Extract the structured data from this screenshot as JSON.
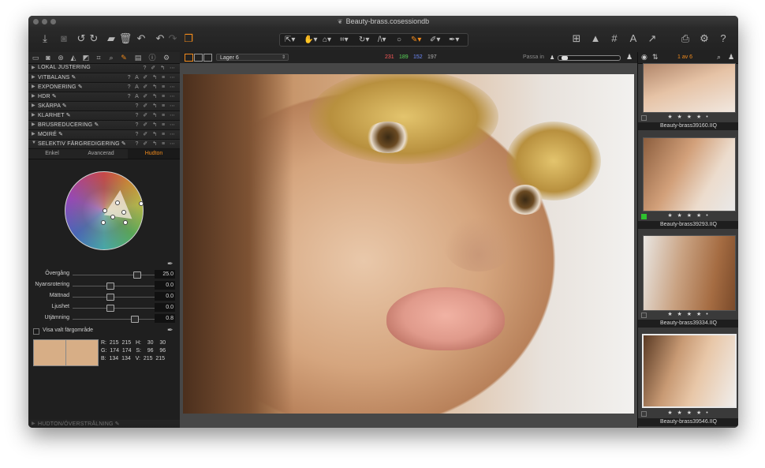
{
  "window": {
    "title": "Beauty-brass.cosessiondb"
  },
  "toolbar": {
    "left_icons": [
      "import-icon",
      "camera-icon",
      "rotate-left-icon",
      "rotate-right-icon",
      "folder-icon",
      "trash-icon",
      "undo-all-icon",
      "undo-icon",
      "redo-icon",
      "stack-icon"
    ],
    "cursor_tools": [
      "pointer-tool-icon",
      "pan-tool-icon",
      "loupe-tool-icon",
      "crop-tool-icon",
      "rotate-tool-icon",
      "keystone-tool-icon",
      "spot-tool-icon",
      "brush-tool-icon",
      "picker-tool-icon",
      "color-picker-tool-icon"
    ],
    "right_icons": [
      "grid-view-icon",
      "warning-icon",
      "overlay-grid-icon",
      "text-annotation-icon",
      "copy-apply-icon",
      "print-icon",
      "settings-icon",
      "help-icon"
    ]
  },
  "left_panel": {
    "tool_tabs": [
      "library-tab-icon",
      "capture-tab-icon",
      "color-tab-icon",
      "exposure-tab-icon",
      "lens-tab-icon",
      "crop-tab-icon",
      "details-tab-icon",
      "local-adjust-tab-icon",
      "metadata-tab-icon",
      "output-tab-icon",
      "batch-tab-icon"
    ],
    "tools": [
      {
        "label": "LOKAL JUSTERING",
        "controls": "? ✐ ↰ ⋯"
      },
      {
        "label": "VITBALANS ✎",
        "controls": "? A ✐ ↰ ≡ ⋯"
      },
      {
        "label": "EXPONERING ✎",
        "controls": "? A ✐ ↰ ≡ ⋯"
      },
      {
        "label": "HDR ✎",
        "controls": "? A ✐ ↰ ≡ ⋯"
      },
      {
        "label": "SKÄRPA ✎",
        "controls": "? ✐ ↰ ≡ ⋯"
      },
      {
        "label": "KLARHET ✎",
        "controls": "? ✐ ↰ ≡ ⋯"
      },
      {
        "label": "BRUSREDUCERING ✎",
        "controls": "? ✐ ↰ ≡ ⋯"
      },
      {
        "label": "MOIRÉ ✎",
        "controls": "? ✐ ↰ ≡ ⋯"
      },
      {
        "label": "SELEKTIV FÄRGREDIGERING ✎",
        "controls": "? ✐ ↰ ≡ ⋯"
      }
    ],
    "subtabs": [
      "Enkel",
      "Avancerad",
      "Hudton"
    ],
    "active_subtab": "Hudton",
    "sliders": [
      {
        "label": "Övergång",
        "value": "25.0",
        "level": 0.78
      },
      {
        "label": "Nyansrotering",
        "value": "0.0",
        "level": 0.45
      },
      {
        "label": "Mättnad",
        "value": "0.0",
        "level": 0.45
      },
      {
        "label": "Ljushet",
        "value": "0.0",
        "level": 0.45
      },
      {
        "label": "Utjämning",
        "value": "0.8",
        "level": 0.75
      }
    ],
    "show_range_label": "Visa valt färgområde",
    "readout": {
      "line1": "R:  215  215   H:    30    30",
      "line2": "G:  174  174   S:    96    96",
      "line3": "B:  134  134   V:  215  215"
    },
    "swatch_color": "#d7ae86",
    "bottom_tool_label": "HUDTON/ÖVERSTRÅLNING ✎"
  },
  "viewer": {
    "layer_label": "Lager 6",
    "rgb": {
      "r": "231",
      "g": "189",
      "b": "152",
      "a": "197"
    },
    "rgb_colors": {
      "r": "#ff5a5a",
      "g": "#59d659",
      "b": "#6f8cff",
      "a": "#b0b0b0"
    },
    "fit_label": "Passa in",
    "zoom_level": 0.05
  },
  "filmstrip": {
    "count_label": "1 av 6",
    "items": [
      {
        "name": "Beauty-brass39160.IIQ",
        "rating": "★ ★ ★ ★ •",
        "tag": "none"
      },
      {
        "name": "Beauty-brass39293.IIQ",
        "rating": "★ ★ ★ ★ •",
        "tag": "green"
      },
      {
        "name": "Beauty-brass39334.IIQ",
        "rating": "★ ★ ★ ★ •",
        "tag": "none"
      },
      {
        "name": "Beauty-brass39546.IIQ",
        "rating": "★ ★ ★ ★ •",
        "tag": "none",
        "selected": true
      }
    ]
  },
  "colors": {
    "accent": "#f08a1c",
    "panel": "#1f1f1f"
  }
}
